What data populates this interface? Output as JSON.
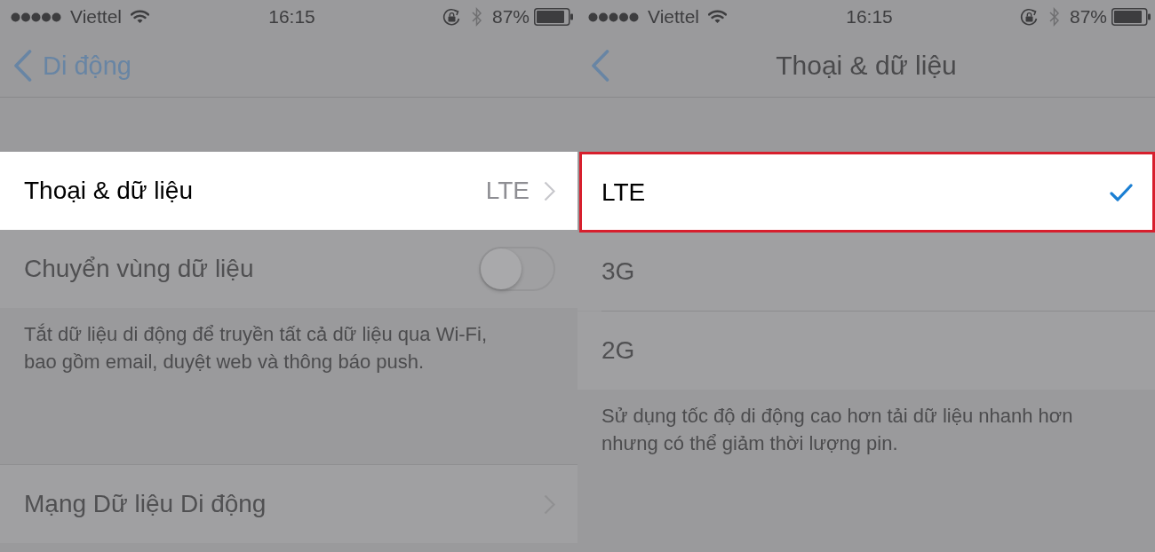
{
  "screens": [
    {
      "status_bar": {
        "carrier": "Viettel",
        "time": "16:15",
        "battery": "87%"
      },
      "nav": {
        "back_label": "Di động"
      },
      "sections": [
        {
          "rows": [
            {
              "kind": "detail",
              "label": "Thoại & dữ liệu",
              "value": "LTE",
              "highlighted": true
            },
            {
              "kind": "toggle",
              "label": "Chuyển vùng dữ liệu",
              "on": false,
              "highlighted": false
            }
          ],
          "footer": "Tắt dữ liệu di động để truyền tất cả dữ liệu qua Wi-Fi, bao gồm email, duyệt web và thông báo push."
        },
        {
          "rows": [
            {
              "kind": "link",
              "label": "Mạng Dữ liệu Di động",
              "highlighted": false
            }
          ]
        }
      ]
    },
    {
      "status_bar": {
        "carrier": "Viettel",
        "time": "16:15",
        "battery": "87%"
      },
      "nav": {
        "title": "Thoại & dữ liệu"
      },
      "sections": [
        {
          "rows": [
            {
              "kind": "option",
              "label": "LTE",
              "selected": true,
              "highlighted": true,
              "outlined": true
            },
            {
              "kind": "option",
              "label": "3G",
              "selected": false,
              "highlighted": false,
              "outlined": false
            },
            {
              "kind": "option",
              "label": "2G",
              "selected": false,
              "highlighted": false,
              "outlined": false
            }
          ],
          "footer": "Sử dụng tốc độ di động cao hơn tải dữ liệu nhanh hơn nhưng có thể giảm thời lượng pin."
        }
      ]
    }
  ]
}
